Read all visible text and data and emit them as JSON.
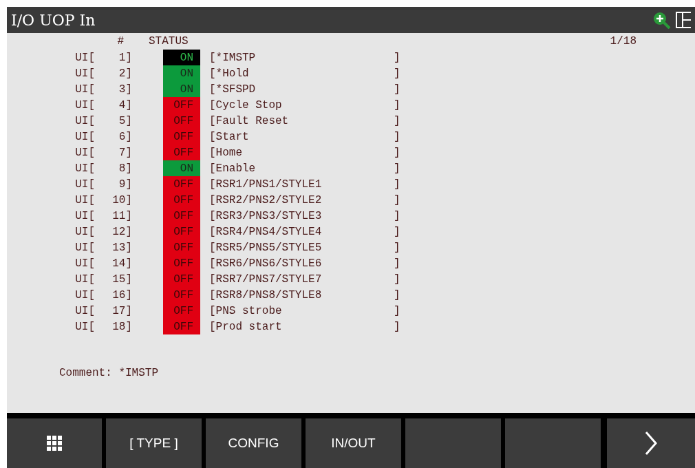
{
  "window": {
    "title": "I/O UOP In"
  },
  "table": {
    "header": {
      "index": "#",
      "status": "STATUS",
      "page": "1/18"
    },
    "rows": [
      {
        "prefix": "UI[",
        "index": "1]",
        "status": "ON",
        "on": true,
        "selected": true,
        "label": "[*IMSTP",
        "close": "]"
      },
      {
        "prefix": "UI[",
        "index": "2]",
        "status": "ON",
        "on": true,
        "selected": false,
        "label": "[*Hold",
        "close": "]"
      },
      {
        "prefix": "UI[",
        "index": "3]",
        "status": "ON",
        "on": true,
        "selected": false,
        "label": "[*SFSPD",
        "close": "]"
      },
      {
        "prefix": "UI[",
        "index": "4]",
        "status": "OFF",
        "on": false,
        "selected": false,
        "label": "[Cycle Stop",
        "close": "]"
      },
      {
        "prefix": "UI[",
        "index": "5]",
        "status": "OFF",
        "on": false,
        "selected": false,
        "label": "[Fault Reset",
        "close": "]"
      },
      {
        "prefix": "UI[",
        "index": "6]",
        "status": "OFF",
        "on": false,
        "selected": false,
        "label": "[Start",
        "close": "]"
      },
      {
        "prefix": "UI[",
        "index": "7]",
        "status": "OFF",
        "on": false,
        "selected": false,
        "label": "[Home",
        "close": "]"
      },
      {
        "prefix": "UI[",
        "index": "8]",
        "status": "ON",
        "on": true,
        "selected": false,
        "label": "[Enable",
        "close": "]"
      },
      {
        "prefix": "UI[",
        "index": "9]",
        "status": "OFF",
        "on": false,
        "selected": false,
        "label": "[RSR1/PNS1/STYLE1",
        "close": "]"
      },
      {
        "prefix": "UI[",
        "index": "10]",
        "status": "OFF",
        "on": false,
        "selected": false,
        "label": "[RSR2/PNS2/STYLE2",
        "close": "]"
      },
      {
        "prefix": "UI[",
        "index": "11]",
        "status": "OFF",
        "on": false,
        "selected": false,
        "label": "[RSR3/PNS3/STYLE3",
        "close": "]"
      },
      {
        "prefix": "UI[",
        "index": "12]",
        "status": "OFF",
        "on": false,
        "selected": false,
        "label": "[RSR4/PNS4/STYLE4",
        "close": "]"
      },
      {
        "prefix": "UI[",
        "index": "13]",
        "status": "OFF",
        "on": false,
        "selected": false,
        "label": "[RSR5/PNS5/STYLE5",
        "close": "]"
      },
      {
        "prefix": "UI[",
        "index": "14]",
        "status": "OFF",
        "on": false,
        "selected": false,
        "label": "[RSR6/PNS6/STYLE6",
        "close": "]"
      },
      {
        "prefix": "UI[",
        "index": "15]",
        "status": "OFF",
        "on": false,
        "selected": false,
        "label": "[RSR7/PNS7/STYLE7",
        "close": "]"
      },
      {
        "prefix": "UI[",
        "index": "16]",
        "status": "OFF",
        "on": false,
        "selected": false,
        "label": "[RSR8/PNS8/STYLE8",
        "close": "]"
      },
      {
        "prefix": "UI[",
        "index": "17]",
        "status": "OFF",
        "on": false,
        "selected": false,
        "label": "[PNS strobe",
        "close": "]"
      },
      {
        "prefix": "UI[",
        "index": "18]",
        "status": "OFF",
        "on": false,
        "selected": false,
        "label": "[Prod start",
        "close": "]"
      }
    ]
  },
  "comment": "Comment: *IMSTP",
  "function_keys": [
    {
      "kind": "menu"
    },
    {
      "kind": "text",
      "label": "[ TYPE ]"
    },
    {
      "kind": "text",
      "label": "CONFIG"
    },
    {
      "kind": "text",
      "label": "IN/OUT"
    },
    {
      "kind": "empty"
    },
    {
      "kind": "empty"
    },
    {
      "kind": "next"
    }
  ]
}
